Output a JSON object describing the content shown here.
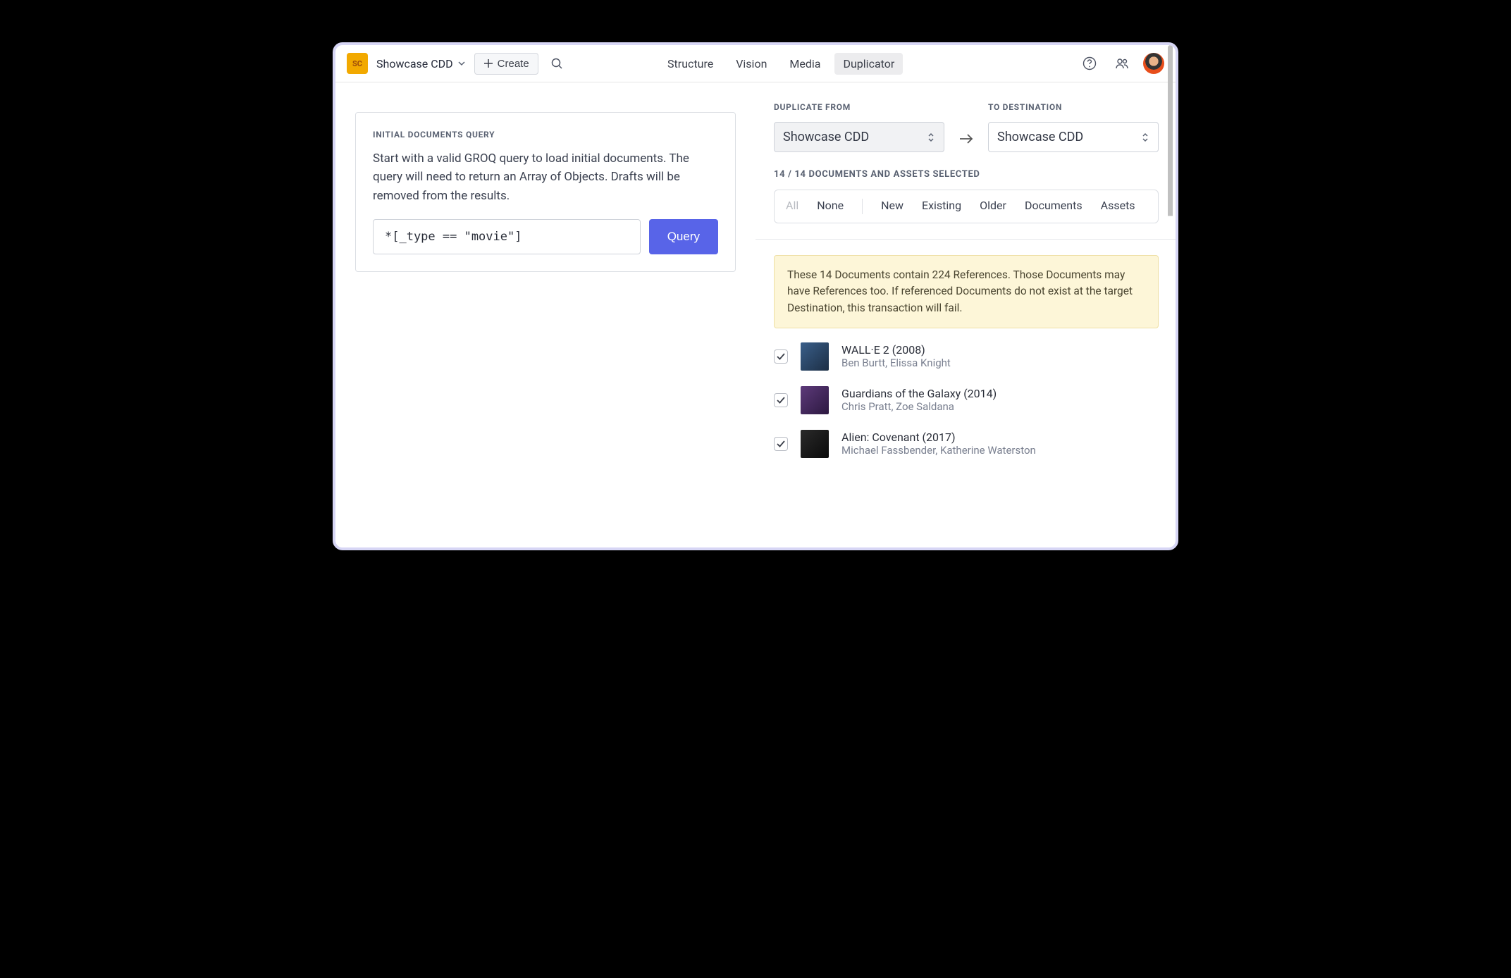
{
  "header": {
    "logo_text": "SC",
    "project_name": "Showcase CDD",
    "create_label": "Create",
    "nav": [
      "Structure",
      "Vision",
      "Media",
      "Duplicator"
    ],
    "active_nav": "Duplicator"
  },
  "query_panel": {
    "label": "INITIAL DOCUMENTS QUERY",
    "description": "Start with a valid GROQ query to load initial documents. The query will need to return an Array of Objects. Drafts will be removed from the results.",
    "input_value": "*[_type == \"movie\"]",
    "button_label": "Query"
  },
  "duplicate": {
    "from_label": "DUPLICATE FROM",
    "to_label": "TO DESTINATION",
    "from_value": "Showcase CDD",
    "to_value": "Showcase CDD",
    "count_label": "14 / 14 DOCUMENTS AND ASSETS SELECTED",
    "filters": {
      "all": "All",
      "none": "None",
      "new": "New",
      "existing": "Existing",
      "older": "Older",
      "documents": "Documents",
      "assets": "Assets"
    },
    "warning": "These 14 Documents contain 224 References. Those Documents may have References too. If referenced Documents do not exist at the target Destination, this transaction will fail.",
    "docs": [
      {
        "title": "WALL·E 2 (2008)",
        "subtitle": "Ben Burtt, Elissa Knight"
      },
      {
        "title": "Guardians of the Galaxy (2014)",
        "subtitle": "Chris Pratt, Zoe Saldana"
      },
      {
        "title": "Alien: Covenant (2017)",
        "subtitle": "Michael Fassbender, Katherine Waterston"
      }
    ]
  }
}
